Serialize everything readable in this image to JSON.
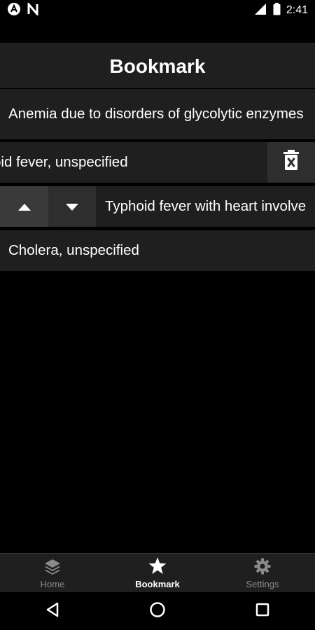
{
  "status_bar": {
    "time": "2:41",
    "left_icons": [
      "app-a-icon",
      "n-icon"
    ],
    "right_icons": [
      "signal-icon",
      "battery-icon"
    ]
  },
  "header": {
    "title": "Bookmark"
  },
  "bookmarks": [
    {
      "label": "Anemia due to disorders of glycolytic enzymes"
    },
    {
      "label": "oid fever, unspecified",
      "revealed_action": "delete"
    },
    {
      "label": "Typhoid fever with heart involve",
      "revealed_actions": [
        "move-up",
        "move-down"
      ]
    },
    {
      "label": "Cholera, unspecified"
    }
  ],
  "tabs": [
    {
      "label": "Home",
      "icon": "layers-icon",
      "active": false
    },
    {
      "label": "Bookmark",
      "icon": "star-icon",
      "active": true
    },
    {
      "label": "Settings",
      "icon": "gear-icon",
      "active": false
    }
  ],
  "nav": [
    "back-icon",
    "home-circle-icon",
    "recents-square-icon"
  ],
  "colors": {
    "background": "#000000",
    "surface": "#1f1f1f",
    "button": "#2e2e2e",
    "button_active": "#3a3a3a",
    "text": "#ffffff",
    "inactive": "#8a8a8a"
  }
}
